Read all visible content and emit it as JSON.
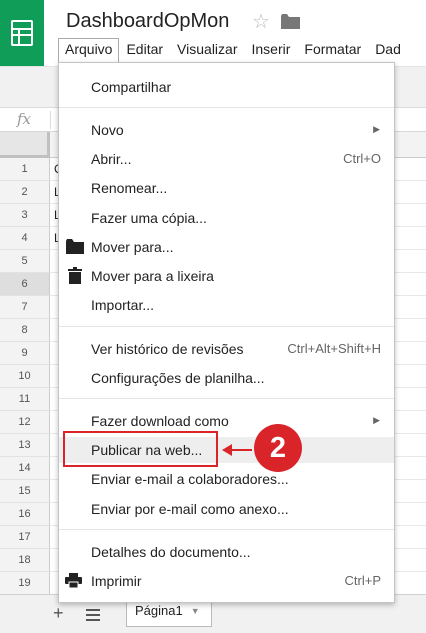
{
  "header": {
    "doc_title": "DashboardOpMon",
    "star_icon": "star-outline-icon",
    "folder_icon": "folder-icon",
    "logo_icon": "sheets-logo-icon"
  },
  "menubar": {
    "items": [
      "Arquivo",
      "Editar",
      "Visualizar",
      "Inserir",
      "Formatar",
      "Dad"
    ]
  },
  "formula_bar": {
    "fx": "fx"
  },
  "grid": {
    "rows": [
      "1",
      "2",
      "3",
      "4",
      "5",
      "6",
      "7",
      "8",
      "9",
      "10",
      "11",
      "12",
      "13",
      "14",
      "15",
      "16",
      "17",
      "18",
      "19"
    ],
    "cells": [
      "C",
      "L",
      "L",
      "L",
      "",
      "",
      "",
      "",
      "",
      "",
      "",
      "",
      "",
      "",
      "",
      "",
      "",
      "",
      ""
    ],
    "selected_row": "6"
  },
  "file_menu": {
    "share": "Compartilhar",
    "new": "Novo",
    "open": "Abrir...",
    "open_shortcut": "Ctrl+O",
    "rename": "Renomear...",
    "make_copy": "Fazer uma cópia...",
    "move_to": "Mover para...",
    "move_to_trash": "Mover para a lixeira",
    "import": "Importar...",
    "revision_history": "Ver histórico de revisões",
    "revision_history_shortcut": "Ctrl+Alt+Shift+H",
    "spreadsheet_settings": "Configurações de planilha...",
    "download_as": "Fazer download como",
    "publish_web": "Publicar na web...",
    "email_collaborators": "Enviar e-mail a colaboradores...",
    "email_attachment": "Enviar por e-mail como anexo...",
    "document_details": "Detalhes do documento...",
    "print": "Imprimir",
    "print_shortcut": "Ctrl+P"
  },
  "annotation": {
    "step": "2",
    "color": "#d9252a"
  },
  "bottom": {
    "add_sheet": "+",
    "sheet_tab": "Página1"
  },
  "colors": {
    "brand_green": "#0f9d58",
    "menu_highlight": "#eeeeee"
  }
}
